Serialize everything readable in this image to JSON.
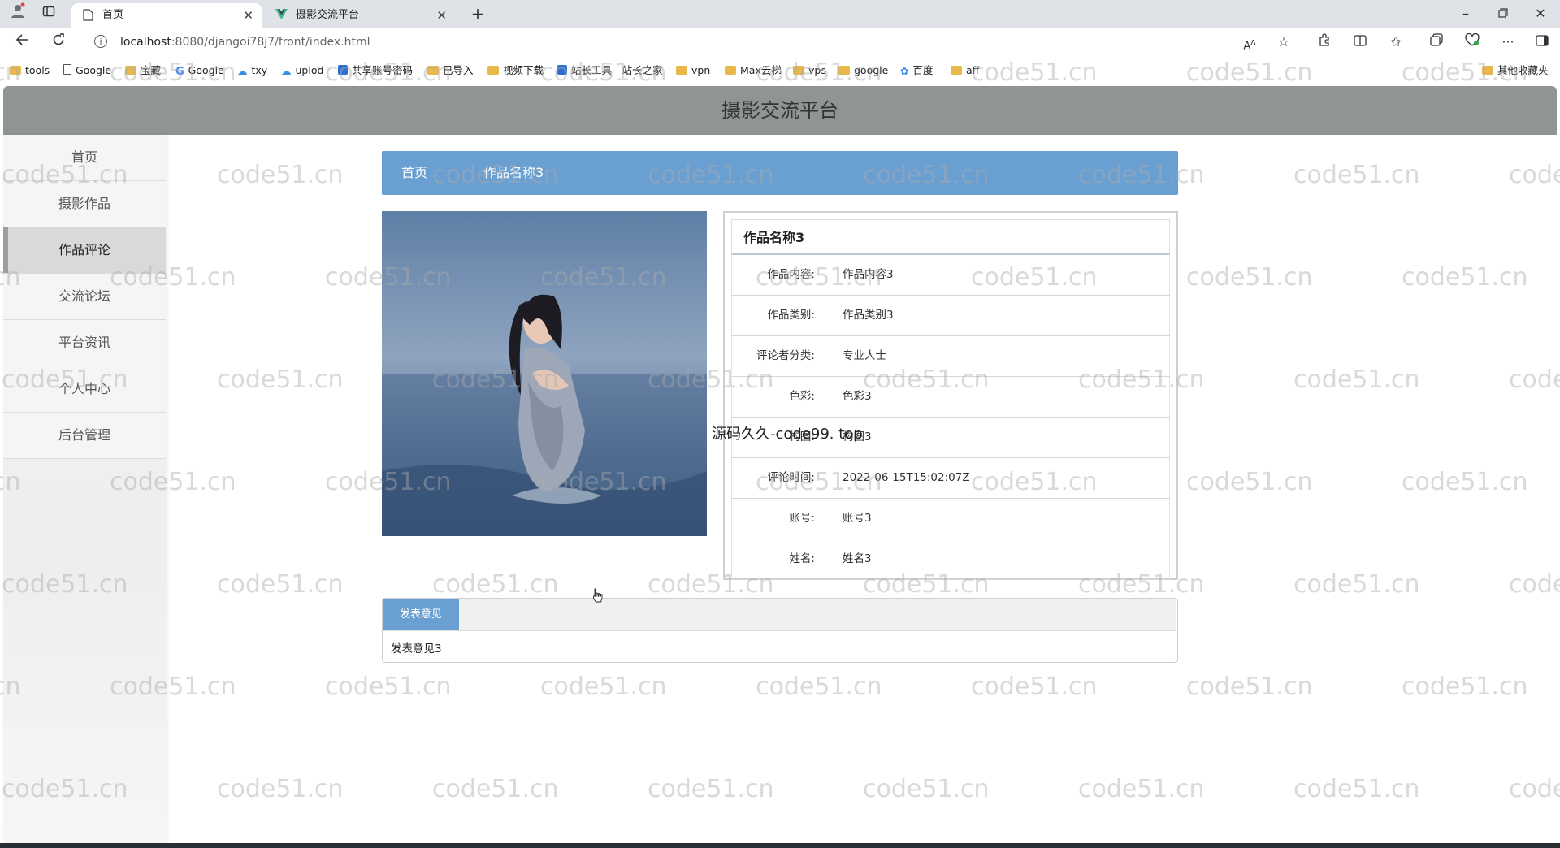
{
  "browser": {
    "tabs": [
      {
        "label": "首页",
        "active": true
      },
      {
        "label": "摄影交流平台",
        "active": false
      }
    ],
    "address": {
      "host": "localhost",
      "rest": ":8080/djangoi78j7/front/index.html"
    },
    "bookmarks": [
      {
        "label": "tools",
        "icon": "folder-icon"
      },
      {
        "label": "Google",
        "icon": "page-icon"
      },
      {
        "label": "宝藏",
        "icon": "folder-icon"
      },
      {
        "label": "Google",
        "icon": "google-icon"
      },
      {
        "label": "txy",
        "icon": "cloud-icon"
      },
      {
        "label": "uplod",
        "icon": "cloud-icon"
      },
      {
        "label": "共享账号密码",
        "icon": "app-icon"
      },
      {
        "label": "已导入",
        "icon": "folder-icon"
      },
      {
        "label": "视频下载",
        "icon": "folder-icon"
      },
      {
        "label": "站长工具 - 站长之家",
        "icon": "app-icon"
      },
      {
        "label": "vpn",
        "icon": "folder-icon"
      },
      {
        "label": "Max云梯",
        "icon": "folder-icon"
      },
      {
        "label": "vps",
        "icon": "folder-icon"
      },
      {
        "label": "google",
        "icon": "folder-icon"
      },
      {
        "label": "百度",
        "icon": "baidu-icon"
      },
      {
        "label": "aff",
        "icon": "folder-icon"
      }
    ],
    "other_bookmarks": "其他收藏夹"
  },
  "site": {
    "title": "摄影交流平台",
    "nav": [
      {
        "label": "首页",
        "active": false
      },
      {
        "label": "摄影作品",
        "active": false
      },
      {
        "label": "作品评论",
        "active": true
      },
      {
        "label": "交流论坛",
        "active": false
      },
      {
        "label": "平台资讯",
        "active": false
      },
      {
        "label": "个人中心",
        "active": false
      },
      {
        "label": "后台管理",
        "active": false
      }
    ],
    "breadcrumb": {
      "home": "首页",
      "current": "作品名称3"
    },
    "detail": {
      "title": "作品名称3",
      "rows": [
        {
          "label": "作品内容:",
          "value": "作品内容3"
        },
        {
          "label": "作品类别:",
          "value": "作品类别3"
        },
        {
          "label": "评论者分类:",
          "value": "专业人士"
        },
        {
          "label": "色彩:",
          "value": "色彩3"
        },
        {
          "label": "构图:",
          "value": "构图3"
        },
        {
          "label": "评论时间:",
          "value": "2022-06-15T15:02:07Z"
        },
        {
          "label": "账号:",
          "value": "账号3"
        },
        {
          "label": "姓名:",
          "value": "姓名3"
        }
      ]
    },
    "comment": {
      "tab": "发表意见",
      "text": "发表意见3"
    }
  },
  "overlay_text": "源码久久-code99. top",
  "watermark": "code51.cn",
  "colors": {
    "accent": "#6a9fd1",
    "header": "#8e9594"
  }
}
